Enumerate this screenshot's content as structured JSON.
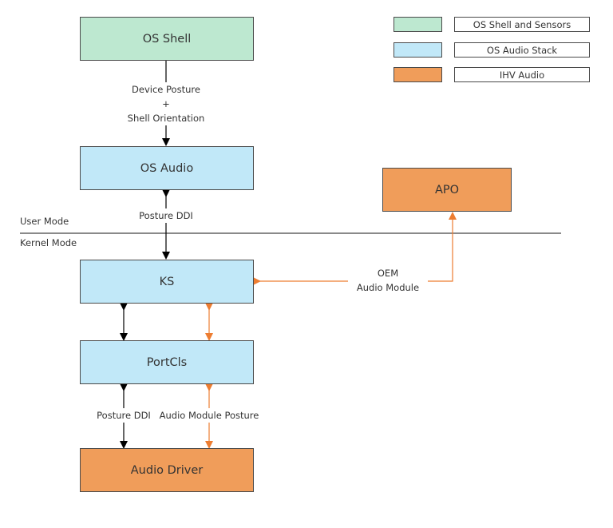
{
  "colors": {
    "os_shell": "#bde8d0",
    "os_audio_stack": "#c1e8f8",
    "ihv_audio": "#f09d5a",
    "black_arrow": "#000000",
    "orange_arrow": "#ed7d31"
  },
  "legend": [
    {
      "label": "OS Shell and Sensors",
      "category": "os_shell"
    },
    {
      "label": "OS Audio Stack",
      "category": "os_audio_stack"
    },
    {
      "label": "IHV Audio",
      "category": "ihv_audio"
    }
  ],
  "nodes": {
    "os_shell": "OS Shell",
    "os_audio": "OS Audio",
    "apo": "APO",
    "ks": "KS",
    "portcls": "PortCls",
    "audio_driver": "Audio Driver"
  },
  "edges": {
    "shell_to_audio_line1": "Device Posture",
    "shell_to_audio_line2": "+",
    "shell_to_audio_line3": "Shell Orientation",
    "posture_ddi_top": "Posture DDI",
    "oem_line1": "OEM",
    "oem_line2": "Audio Module",
    "posture_ddi_bottom": "Posture DDI",
    "audio_module_posture": "Audio Module Posture"
  },
  "modes": {
    "user": "User Mode",
    "kernel": "Kernel Mode"
  }
}
